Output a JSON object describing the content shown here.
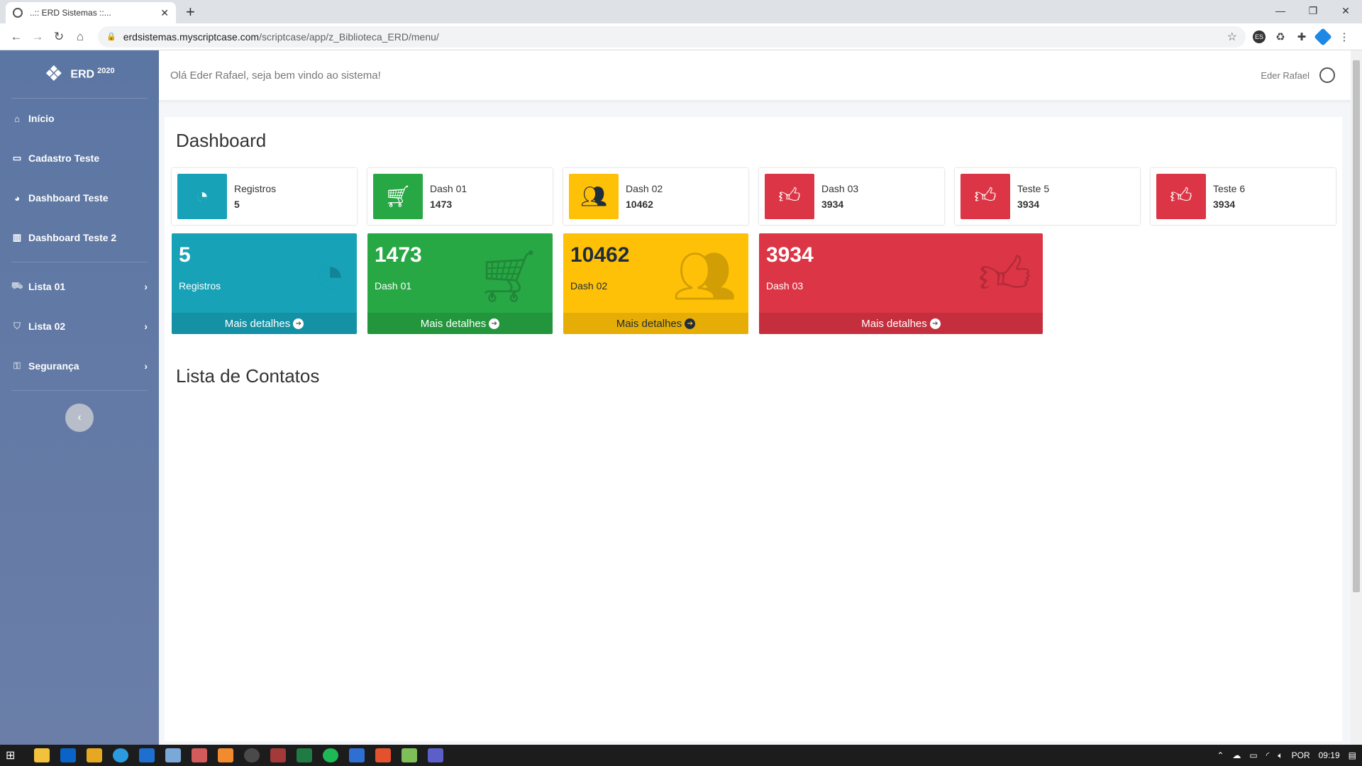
{
  "browser": {
    "tab_title": "..:: ERD Sistemas ::...",
    "tab_close": "✕",
    "new_tab": "+",
    "url_host": "erdsistemas.myscriptcase.com",
    "url_path": "/scriptcase/app/z_Biblioteca_ERD/menu/",
    "minimize": "—",
    "restore": "❐",
    "close": "✕",
    "ext_label": "ES"
  },
  "sidebar": {
    "brand": "ERD",
    "brand_year": "2020",
    "items": [
      {
        "label": "Início",
        "icon": "home-icon"
      },
      {
        "label": "Cadastro Teste",
        "icon": "monitor-icon"
      },
      {
        "label": "Dashboard Teste",
        "icon": "pie-chart-icon"
      },
      {
        "label": "Dashboard Teste 2",
        "icon": "bar-chart-icon"
      },
      {
        "label": "Lista 01",
        "icon": "truck-icon"
      },
      {
        "label": "Lista 02",
        "icon": "tags-icon"
      },
      {
        "label": "Segurança",
        "icon": "lock-icon"
      }
    ],
    "collapse_glyph": "‹"
  },
  "header": {
    "welcome": "Olá Eder Rafael, seja bem vindo ao sistema!",
    "user_name": "Eder Rafael"
  },
  "main": {
    "title": "Dashboard",
    "info_boxes": [
      {
        "label": "Registros",
        "value": "5",
        "color": "#17a2b8",
        "icon": "tachometer-icon"
      },
      {
        "label": "Dash 01",
        "value": "1473",
        "color": "#28a745",
        "icon": "cart-icon"
      },
      {
        "label": "Dash 02",
        "value": "10462",
        "color": "#ffc107",
        "icon": "users-icon"
      },
      {
        "label": "Dash 03",
        "value": "3934",
        "color": "#dc3545",
        "icon": "thumbs-up-icon"
      },
      {
        "label": "Teste 5",
        "value": "3934",
        "color": "#dc3545",
        "icon": "thumbs-up-icon"
      },
      {
        "label": "Teste 6",
        "value": "3934",
        "color": "#dc3545",
        "icon": "thumbs-up-icon"
      }
    ],
    "small_boxes": [
      {
        "value": "5",
        "label": "Registros",
        "more": "Mais detalhes",
        "color": "#17a2b8",
        "icon": "tachometer-icon"
      },
      {
        "value": "1473",
        "label": "Dash 01",
        "more": "Mais detalhes",
        "color": "#28a745",
        "icon": "cart-icon"
      },
      {
        "value": "10462",
        "label": "Dash 02",
        "more": "Mais detalhes",
        "color": "#ffc107",
        "icon": "users-icon"
      },
      {
        "value": "3934",
        "label": "Dash 03",
        "more": "Mais detalhes",
        "color": "#dc3545",
        "icon": "thumbs-up-icon"
      }
    ],
    "section_title": "Lista de Contatos"
  },
  "taskbar": {
    "lang": "POR",
    "time": "09:19"
  }
}
